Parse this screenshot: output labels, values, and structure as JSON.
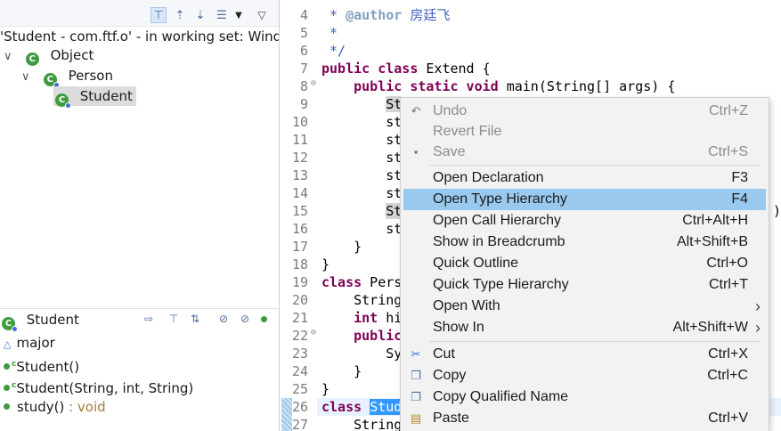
{
  "left_panel": {
    "hierarchy_title": "'Student - com.ftf.o' - in working set: Windo",
    "tree": [
      {
        "label": "Object"
      },
      {
        "label": "Person"
      },
      {
        "label": "Student"
      }
    ],
    "members_title": "Student",
    "members": [
      {
        "name": "major",
        "type": ""
      },
      {
        "name": "Student()",
        "type": ""
      },
      {
        "name": "Student(String, int, String)",
        "type": ""
      },
      {
        "name": "study()",
        "type": " : void"
      }
    ]
  },
  "editor": {
    "lines": [
      {
        "n": "4",
        "parts": [
          {
            "t": " * ",
            "c": "jd"
          },
          {
            "t": "@author",
            "c": "jdtag"
          },
          {
            "t": " 房廷飞",
            "c": "jd"
          }
        ]
      },
      {
        "n": "5",
        "parts": [
          {
            "t": " *",
            "c": "jd"
          }
        ]
      },
      {
        "n": "6",
        "parts": [
          {
            "t": " */",
            "c": "jd"
          }
        ]
      },
      {
        "n": "7",
        "parts": [
          {
            "t": "public class",
            "c": "kw"
          },
          {
            "t": " Extend {",
            "c": ""
          }
        ]
      },
      {
        "n": "8",
        "parts": [
          {
            "t": "    ",
            "c": ""
          },
          {
            "t": "public static void",
            "c": "kw"
          },
          {
            "t": " main(String[] args) {",
            "c": ""
          }
        ]
      },
      {
        "n": "9",
        "parts": [
          {
            "t": "        ",
            "c": ""
          },
          {
            "t": "St",
            "c": "hl"
          }
        ]
      },
      {
        "n": "10",
        "parts": [
          {
            "t": "        st",
            "c": ""
          }
        ]
      },
      {
        "n": "11",
        "parts": [
          {
            "t": "        st",
            "c": ""
          }
        ]
      },
      {
        "n": "12",
        "parts": [
          {
            "t": "        st",
            "c": ""
          }
        ]
      },
      {
        "n": "13",
        "parts": [
          {
            "t": "        st",
            "c": ""
          }
        ]
      },
      {
        "n": "14",
        "parts": [
          {
            "t": "        st",
            "c": ""
          }
        ]
      },
      {
        "n": "15",
        "parts": [
          {
            "t": "        ",
            "c": ""
          },
          {
            "t": "St",
            "c": "hl"
          }
        ]
      },
      {
        "n": "16",
        "parts": [
          {
            "t": "        st",
            "c": ""
          }
        ]
      },
      {
        "n": "17",
        "parts": [
          {
            "t": "    }",
            "c": ""
          }
        ]
      },
      {
        "n": "18",
        "parts": [
          {
            "t": "}",
            "c": ""
          }
        ]
      },
      {
        "n": "19",
        "parts": [
          {
            "t": "class",
            "c": "kw"
          },
          {
            "t": " Pers",
            "c": ""
          }
        ]
      },
      {
        "n": "20",
        "parts": [
          {
            "t": "    String",
            "c": ""
          }
        ]
      },
      {
        "n": "21",
        "parts": [
          {
            "t": "    ",
            "c": ""
          },
          {
            "t": "int",
            "c": "kw"
          },
          {
            "t": " hi",
            "c": ""
          }
        ]
      },
      {
        "n": "22",
        "parts": [
          {
            "t": "    ",
            "c": ""
          },
          {
            "t": "public",
            "c": "kw"
          }
        ]
      },
      {
        "n": "23",
        "parts": [
          {
            "t": "        Sy",
            "c": ""
          }
        ]
      },
      {
        "n": "24",
        "parts": [
          {
            "t": "    }",
            "c": ""
          }
        ]
      },
      {
        "n": "25",
        "parts": [
          {
            "t": "}",
            "c": ""
          }
        ]
      },
      {
        "n": "26",
        "parts": [
          {
            "t": "class",
            "c": "kw"
          },
          {
            "t": " ",
            "c": ""
          },
          {
            "t": "Stud",
            "c": "selblue"
          }
        ]
      },
      {
        "n": "27",
        "parts": [
          {
            "t": "    String",
            "c": ""
          }
        ]
      }
    ],
    "overflow_line15": ";",
    "overflow_line14": ")"
  },
  "context_menu": {
    "items": [
      {
        "label": "Undo",
        "shortcut": "Ctrl+Z",
        "disabled": true,
        "icon": "undo-icon"
      },
      {
        "label": "Revert File",
        "shortcut": "",
        "disabled": true,
        "icon": ""
      },
      {
        "label": "Save",
        "shortcut": "Ctrl+S",
        "disabled": true,
        "icon": "save-icon"
      },
      {
        "label": "Open Declaration",
        "shortcut": "F3",
        "disabled": false,
        "icon": ""
      },
      {
        "label": "Open Type Hierarchy",
        "shortcut": "F4",
        "disabled": false,
        "icon": "",
        "highlighted": true
      },
      {
        "label": "Open Call Hierarchy",
        "shortcut": "Ctrl+Alt+H",
        "disabled": false,
        "icon": ""
      },
      {
        "label": "Show in Breadcrumb",
        "shortcut": "Alt+Shift+B",
        "disabled": false,
        "icon": ""
      },
      {
        "label": "Quick Outline",
        "shortcut": "Ctrl+O",
        "disabled": false,
        "icon": ""
      },
      {
        "label": "Quick Type Hierarchy",
        "shortcut": "Ctrl+T",
        "disabled": false,
        "icon": ""
      },
      {
        "label": "Open With",
        "shortcut": "",
        "disabled": false,
        "icon": "",
        "submenu": true
      },
      {
        "label": "Show In",
        "shortcut": "Alt+Shift+W",
        "disabled": false,
        "icon": "",
        "submenu": true
      },
      {
        "label": "Cut",
        "shortcut": "Ctrl+X",
        "disabled": false,
        "icon": "scissors-icon"
      },
      {
        "label": "Copy",
        "shortcut": "Ctrl+C",
        "disabled": false,
        "icon": "copy-icon"
      },
      {
        "label": "Copy Qualified Name",
        "shortcut": "",
        "disabled": false,
        "icon": "copy-qualified-icon"
      },
      {
        "label": "Paste",
        "shortcut": "Ctrl+V",
        "disabled": false,
        "icon": "paste-icon"
      }
    ]
  },
  "colors": {
    "menu_highlight": "#99c9ef",
    "keyword": "#7f0055",
    "javadoc": "#3f5fbf",
    "selection": "#3399ff"
  }
}
